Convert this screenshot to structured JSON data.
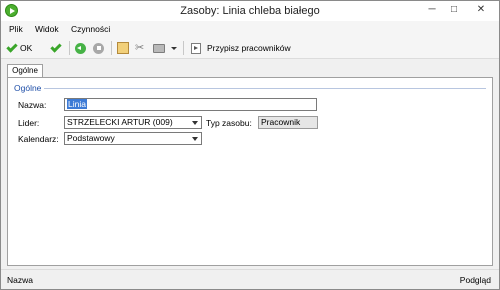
{
  "window": {
    "title": "Zasoby: Linia chleba białego",
    "controls": {
      "minimize": "─",
      "maximize": "□",
      "close": "✕"
    }
  },
  "menu": {
    "items": [
      "Plik",
      "Widok",
      "Czynności"
    ]
  },
  "toolbar": {
    "ok_label": "OK",
    "assign_label": "Przypisz pracowników",
    "icons": [
      "check-icon",
      "check-save-icon",
      "back-icon",
      "stop-icon",
      "attach-icon",
      "tools-icon",
      "print-icon",
      "dropdown-icon",
      "assign-icon"
    ]
  },
  "tabs": [
    {
      "label": "Ogólne",
      "active": true
    }
  ],
  "form": {
    "group_title": "Ogólne",
    "name": {
      "label": "Nazwa:",
      "value": "Linia"
    },
    "leader": {
      "label": "Lider:",
      "value": "STRZELECKI ARTUR (009)"
    },
    "resource_type": {
      "label": "Typ zasobu:",
      "value": "Pracownik"
    },
    "calendar": {
      "label": "Kalendarz:",
      "value": "Podstawowy"
    }
  },
  "status": {
    "left": "Nazwa",
    "right": "Podgląd"
  },
  "colors": {
    "accent": "#3d7bd6",
    "group_title": "#1f4fa8",
    "ok_green": "#3aa62a"
  }
}
